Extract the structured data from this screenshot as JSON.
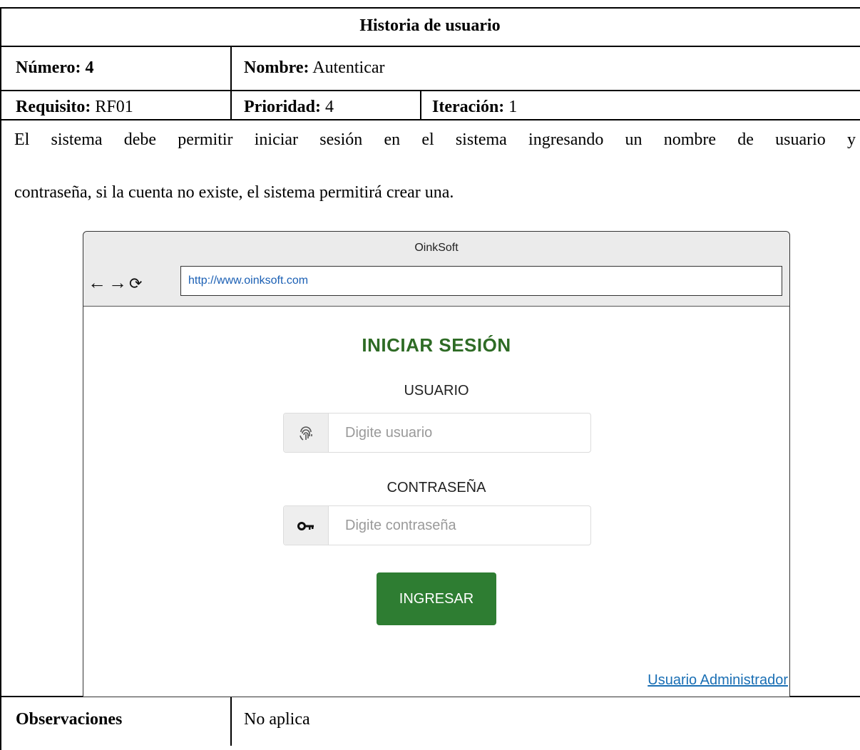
{
  "document": {
    "title": "Historia de usuario",
    "numero": {
      "label": "Número:",
      "value": "4"
    },
    "nombre": {
      "label": "Nombre:",
      "value": "Autenticar"
    },
    "requisito": {
      "label": "Requisito:",
      "value": "RF01"
    },
    "prioridad": {
      "label": "Prioridad:",
      "value": "4"
    },
    "iteracion": {
      "label": "Iteración:",
      "value": "1"
    },
    "description_line1": "El sistema debe permitir iniciar sesión en el sistema ingresando un nombre de usuario y",
    "description_line2": "contraseña, si la cuenta no existe, el sistema permitirá crear una.",
    "observaciones": {
      "label": "Observaciones",
      "value": "No aplica"
    }
  },
  "mockup": {
    "window_title": "OinkSoft",
    "nav": {
      "back_icon": "arrow-left-icon",
      "forward_icon": "arrow-right-icon",
      "reload_icon": "reload-icon"
    },
    "url": "http://www.oinksoft.com",
    "login_title": "INICIAR SESIÓN",
    "usuario_label": "USUARIO",
    "usuario_placeholder": "Digite usuario",
    "usuario_icon": "fingerprint-icon",
    "password_label": "CONTRASEÑA",
    "password_placeholder": "Digite contraseña",
    "password_icon": "key-icon",
    "submit_label": "INGRESAR",
    "admin_link": "Usuario Administrador",
    "colors": {
      "title": "#2e6b25",
      "button": "#2e7d32",
      "link": "#1a6fb4"
    }
  }
}
